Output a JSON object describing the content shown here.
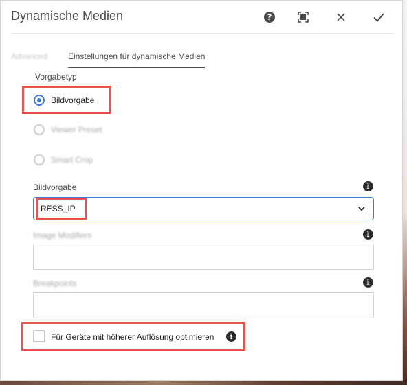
{
  "dialog": {
    "title": "Dynamische Medien",
    "header_icons": [
      "help-icon",
      "fullscreen-icon",
      "close-icon",
      "check-icon"
    ]
  },
  "tabs": [
    {
      "label": "Advanced",
      "active": false
    },
    {
      "label": "Einstellungen für dynamische Medien",
      "active": true
    }
  ],
  "preset_type": {
    "label": "Vorgabetyp",
    "options": [
      {
        "label": "Bildvorgabe",
        "selected": true
      },
      {
        "label": "Viewer Preset",
        "selected": false
      },
      {
        "label": "Smart Crop",
        "selected": false
      }
    ]
  },
  "image_preset": {
    "label": "Bildvorgabe",
    "value": "RESS_IP"
  },
  "image_modifiers": {
    "label": "Image Modifiers",
    "value": ""
  },
  "breakpoints": {
    "label": "Breakpoints",
    "value": ""
  },
  "hires_checkbox": {
    "label": "Für Geräte mit höherer Auflösung optimieren",
    "checked": false
  },
  "colors": {
    "accent": "#3d7cd4",
    "highlight": "#e9524f",
    "text": "#4b4b4b"
  }
}
